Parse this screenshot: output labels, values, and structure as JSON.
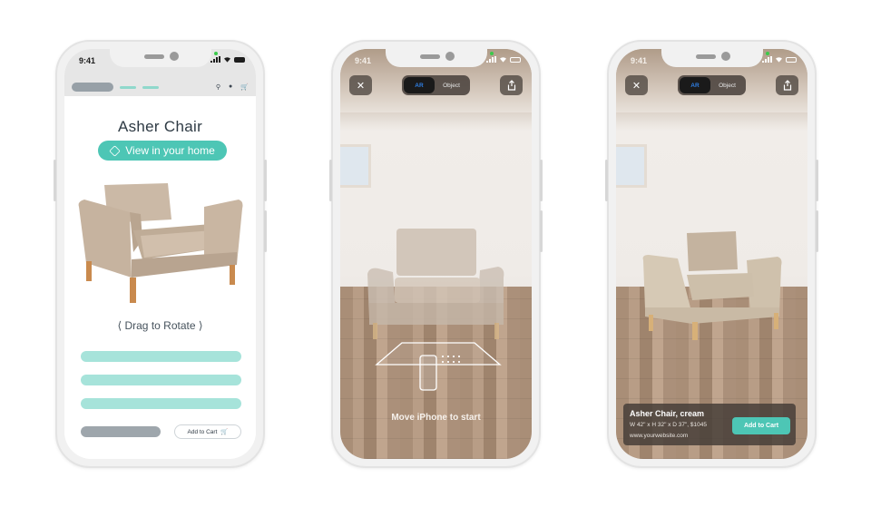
{
  "status_bar": {
    "time": "9:41"
  },
  "product_page": {
    "title": "Asher Chair",
    "view_in_home_label": "View in your home",
    "drag_hint": "Drag to Rotate",
    "add_to_cart_label": "Add to Cart",
    "nav_icons": [
      "search-icon",
      "user-icon",
      "cart-icon"
    ]
  },
  "ar_view": {
    "close_icon": "close-icon",
    "mode_toggle": {
      "options": [
        "AR",
        "Object"
      ],
      "selected": "AR"
    },
    "share_icon": "share-icon",
    "instruction": "Move iPhone to start"
  },
  "ar_placed": {
    "product_name": "Asher Chair, cream",
    "dimensions_price": "W 42\" x H 32\" x D 37\", $1045",
    "website": "www.yourwebsite.com",
    "add_to_cart_label": "Add to Cart"
  },
  "colors": {
    "accent_teal": "#4dc6b5",
    "light_teal": "#a6e3da",
    "grey_placeholder": "#9ea6ac",
    "ar_mode_blue": "#2f7fe4"
  }
}
